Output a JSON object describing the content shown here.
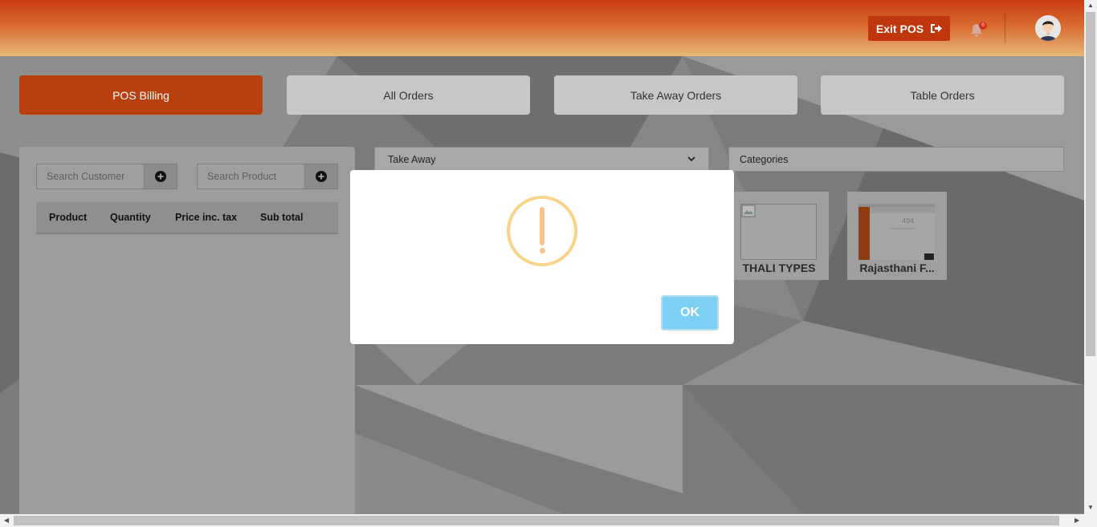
{
  "header": {
    "exit_label": "Exit POS",
    "notification_count": "0"
  },
  "tabs": [
    {
      "label": "POS Billing",
      "active": true
    },
    {
      "label": "All Orders",
      "active": false
    },
    {
      "label": "Take Away Orders",
      "active": false
    },
    {
      "label": "Table Orders",
      "active": false
    }
  ],
  "billing": {
    "search_customer_placeholder": "Search Customer",
    "search_product_placeholder": "Search Product",
    "columns": [
      "Product",
      "Quantity",
      "Price inc. tax",
      "Sub total"
    ]
  },
  "order_type": {
    "selected": "Take Away"
  },
  "categories": {
    "label": "Categories",
    "items": [
      {
        "name": "THALI TYPES"
      },
      {
        "name": "Rajasthani F..."
      }
    ]
  },
  "dialog": {
    "icon": "warning-icon",
    "ok_label": "OK"
  },
  "colors": {
    "brand": "#c0360d",
    "warning": "#f8d48b",
    "ok_button": "#7ecff4"
  }
}
